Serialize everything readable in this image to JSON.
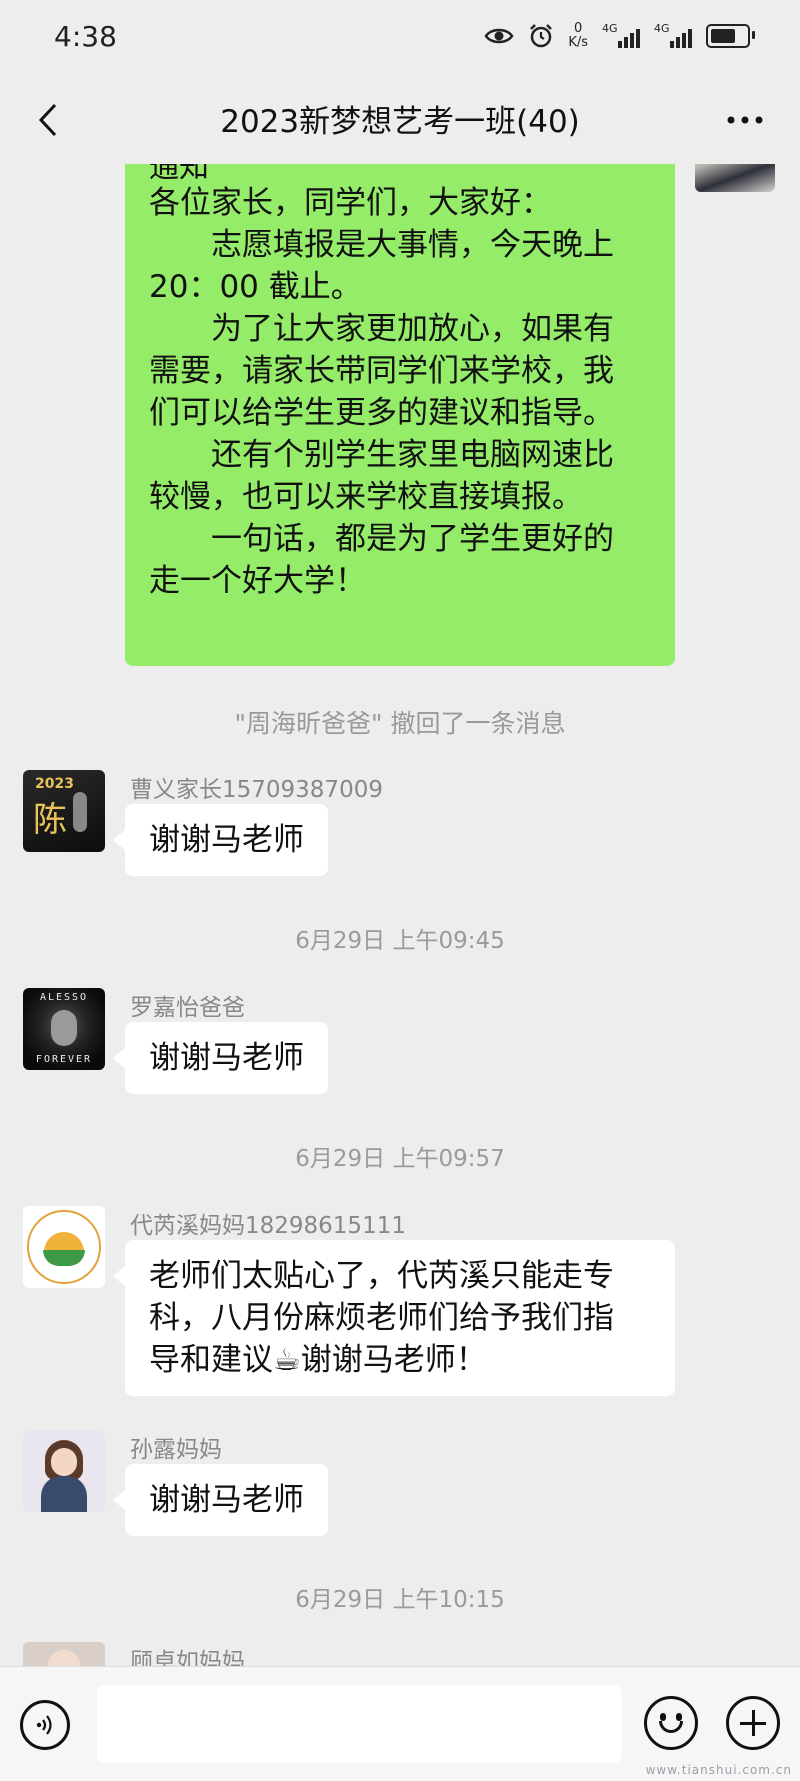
{
  "status_bar": {
    "time": "4:38",
    "net_speed_value": "0",
    "net_speed_unit": "K/s",
    "signal_1": "4G",
    "signal_2": "4G"
  },
  "header": {
    "title": "2023新梦想艺考一班(40)"
  },
  "chat": {
    "self_message": {
      "peek_text": "通知",
      "lines": [
        "各位家长，同学们，大家好：",
        "　　志愿填报是大事情，今天晚上",
        "20：00 截止。",
        "　　为了让大家更加放心，如果有",
        "需要，请家长带同学们来学校，我",
        "们可以给学生更多的建议和指导。",
        "　　还有个别学生家里电脑网速比",
        "较慢，也可以来学校直接填报。",
        "　　一句话，都是为了学生更好的",
        "走一个好大学！"
      ]
    },
    "recall_notice": "\"周海昕爸爸\" 撤回了一条消息",
    "messages": [
      {
        "sender": "曹义家长15709387009",
        "avatar_text_year": "2023",
        "avatar_text_name": "陈",
        "lines": [
          "谢谢马老师"
        ]
      },
      {
        "sender": "罗嘉怡爸爸",
        "avatar_text_top": "ALESSO",
        "avatar_text_bottom": "FOREVER",
        "lines": [
          "谢谢马老师"
        ]
      },
      {
        "sender": "代芮溪妈妈18298615111",
        "lines": [
          "老师们太贴心了，代芮溪只能走专",
          "科，八月份麻烦老师们给予我们指",
          "导和建议☕谢谢马老师！"
        ]
      },
      {
        "sender": "孙露妈妈",
        "lines": [
          "谢谢马老师"
        ]
      },
      {
        "sender": "顾卓如妈妈",
        "lines": []
      }
    ],
    "timestamps": [
      "6月29日 上午09:45",
      "6月29日 上午09:57",
      "6月29日 上午10:15"
    ]
  },
  "input_bar": {
    "voice_icon": "voice-icon",
    "emoji_icon": "emoji-icon",
    "plus_icon": "plus-icon"
  },
  "watermark": "www.tianshui.com.cn"
}
